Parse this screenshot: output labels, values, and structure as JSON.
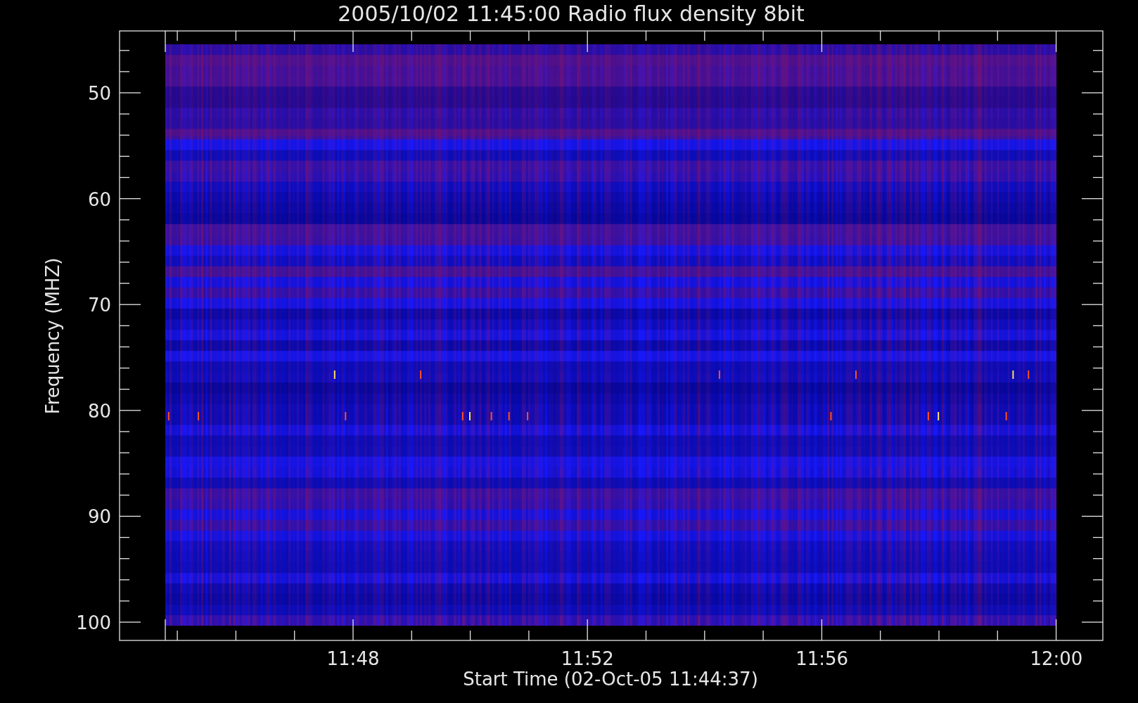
{
  "plot": {
    "title": "2005/10/02 11:45:00 Radio flux density 8bit",
    "ylabel": "Frequency (MHZ)",
    "xlabel": "Start Time (02-Oct-05 11:44:37)",
    "yticks": [
      "50",
      "60",
      "70",
      "80",
      "90",
      "100"
    ],
    "xticks": [
      "11:48",
      "11:52",
      "11:56",
      "12:00"
    ]
  }
}
